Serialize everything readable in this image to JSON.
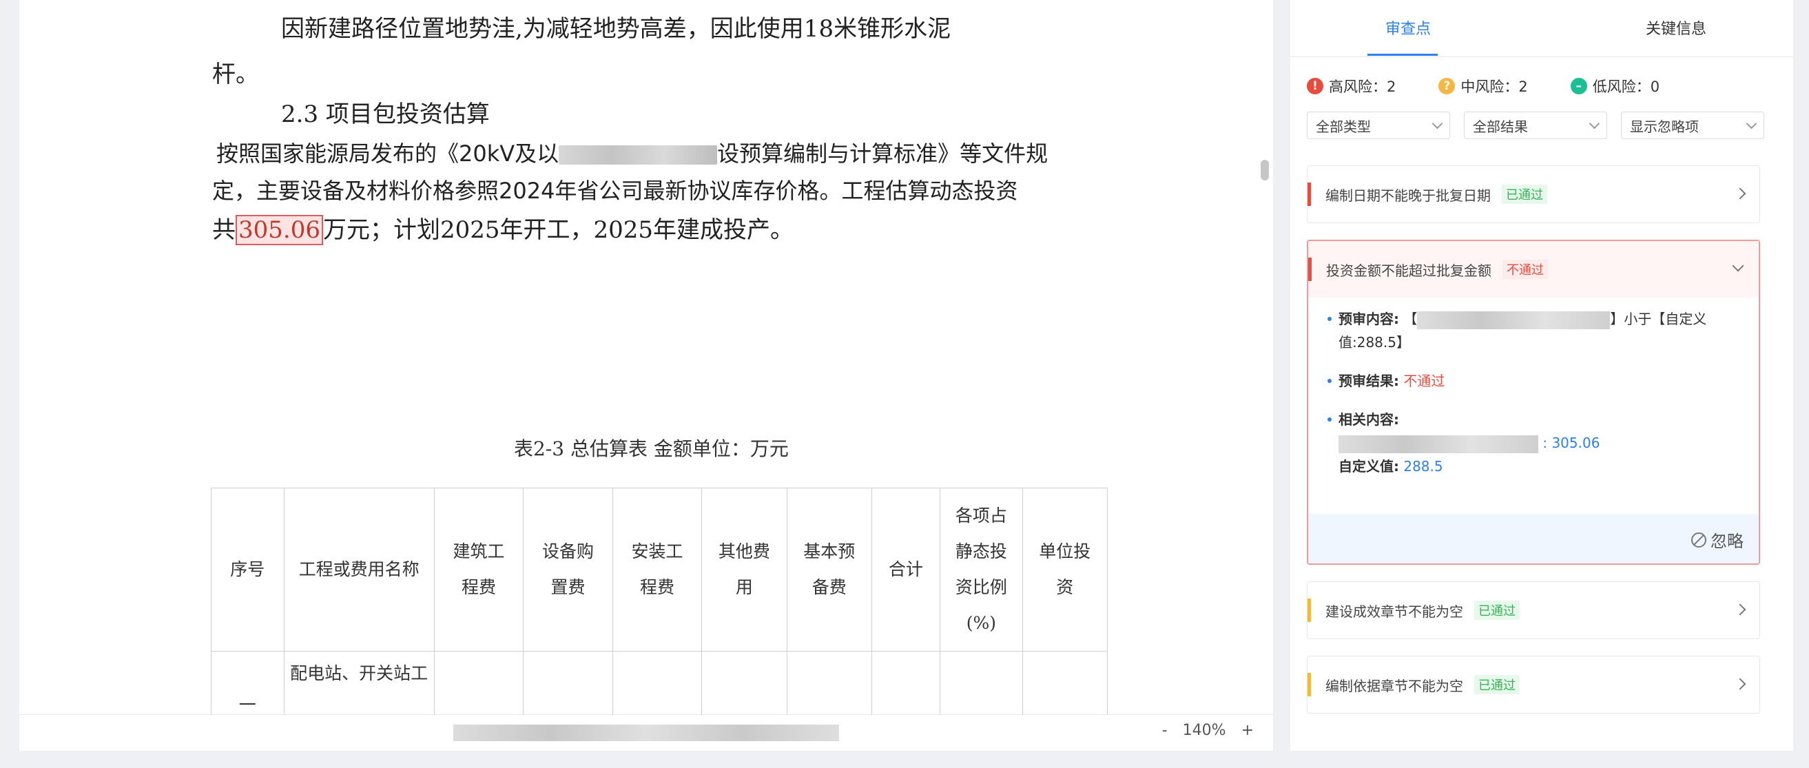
{
  "document": {
    "line1": "因新建路径位置地势洼,为减轻地势高差，因此使用18米锥形水泥",
    "line2": "杆。",
    "section_heading": "2.3 项目包投资估算",
    "para_prefix": "按照国家能源局发布的《20kV及以",
    "para_suffix": "设预算编制与计算标准》等文件规",
    "para_line2": "定，主要设备及材料价格参照2024年省公司最新协议库存价格。工程估算动态投资",
    "para_line3_a": "共",
    "para_line3_hl": "305.06",
    "para_line3_b": "万元；计划2025年开工，2025年建成投产。",
    "table_caption": "表2-3 总估算表 金额单位：万元",
    "table_headers": [
      "序号",
      "工程或费用名称",
      "建筑工程费",
      "设备购置费",
      "安装工程费",
      "其他费用",
      "基本预备费",
      "合计",
      "各项占静态投资比例(%)",
      "单位投资"
    ],
    "table_row1": {
      "index": "一",
      "name": "配电站、开关站工"
    },
    "zoom_level": "140%",
    "zoom_minus": "-",
    "zoom_plus": "+"
  },
  "review": {
    "tabs": [
      "审查点",
      "关键信息"
    ],
    "risk": {
      "high": "高风险：2",
      "mid": "中风险：2",
      "low": "低风险：0"
    },
    "filters": [
      "全部类型",
      "全部结果",
      "显示忽略项"
    ],
    "cards": [
      {
        "title": "编制日期不能晚于批复日期",
        "status": "已通过",
        "risk": "high"
      },
      {
        "title": "投资金额不能超过批复金额",
        "status": "不通过",
        "risk": "high",
        "pre_content_label": "预审内容:",
        "pre_content_open": "【",
        "pre_content_close": "】小于【自定义",
        "pre_content_line2": "值:288.5】",
        "pre_result_label": "预审结果:",
        "pre_result_value": "不通过",
        "related_label": "相关内容:",
        "related_value": ": 305.06",
        "custom_label": "自定义值:",
        "custom_value": "288.5",
        "ignore_label": "忽略"
      },
      {
        "title": "建设成效章节不能为空",
        "status": "已通过",
        "risk": "mid"
      },
      {
        "title": "编制依据章节不能为空",
        "status": "已通过",
        "risk": "mid"
      }
    ]
  },
  "colors": {
    "accent": "#2f80ed",
    "high_risk": "#e74c3c",
    "mid_risk": "#f5b642",
    "low_risk": "#1bbf94",
    "pass": "#2eb84f"
  }
}
